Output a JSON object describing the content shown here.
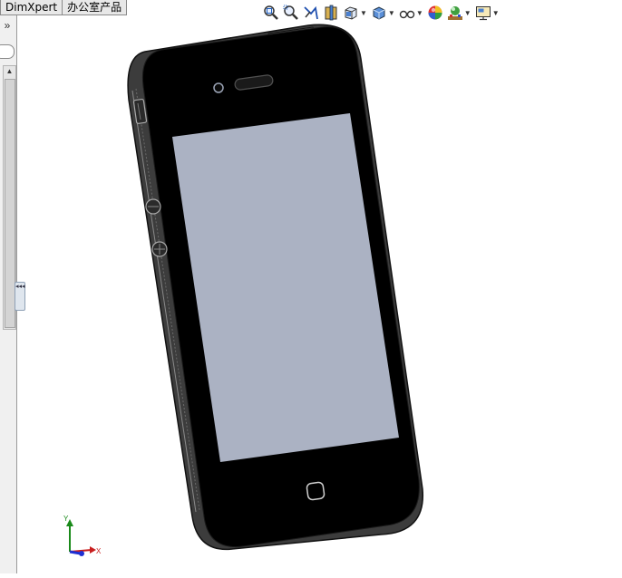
{
  "tabs": [
    {
      "label": "DimXpert"
    },
    {
      "label": "办公室产品"
    }
  ],
  "left_panel": {
    "expand_glyph": "»",
    "scroll_up_glyph": "▲",
    "splitter_glyph": "◂◂◂"
  },
  "toolbar": {
    "items": [
      {
        "icon": "zoom-to-fit-icon",
        "dropdown": false
      },
      {
        "icon": "zoom-to-area-icon",
        "dropdown": false
      },
      {
        "icon": "previous-view-icon",
        "dropdown": false
      },
      {
        "icon": "section-view-icon",
        "dropdown": false
      },
      {
        "icon": "view-orientation-icon",
        "dropdown": true
      },
      {
        "icon": "display-style-icon",
        "dropdown": true
      },
      {
        "icon": "hide-show-items-icon",
        "dropdown": true
      },
      {
        "icon": "edit-appearance-icon",
        "dropdown": false
      },
      {
        "icon": "apply-scene-icon",
        "dropdown": true
      },
      {
        "icon": "view-settings-icon",
        "dropdown": true
      }
    ]
  },
  "triad": {
    "y_label": "Y",
    "x_label": "X"
  },
  "colors": {
    "background": "#ffffff",
    "phone_body": "#000000",
    "phone_bezel": "#3c3c3c",
    "screen": "#abb2c3",
    "triad_y": "#1a8a1a",
    "triad_x": "#c81e1e",
    "triad_z": "#1e2ed2"
  }
}
